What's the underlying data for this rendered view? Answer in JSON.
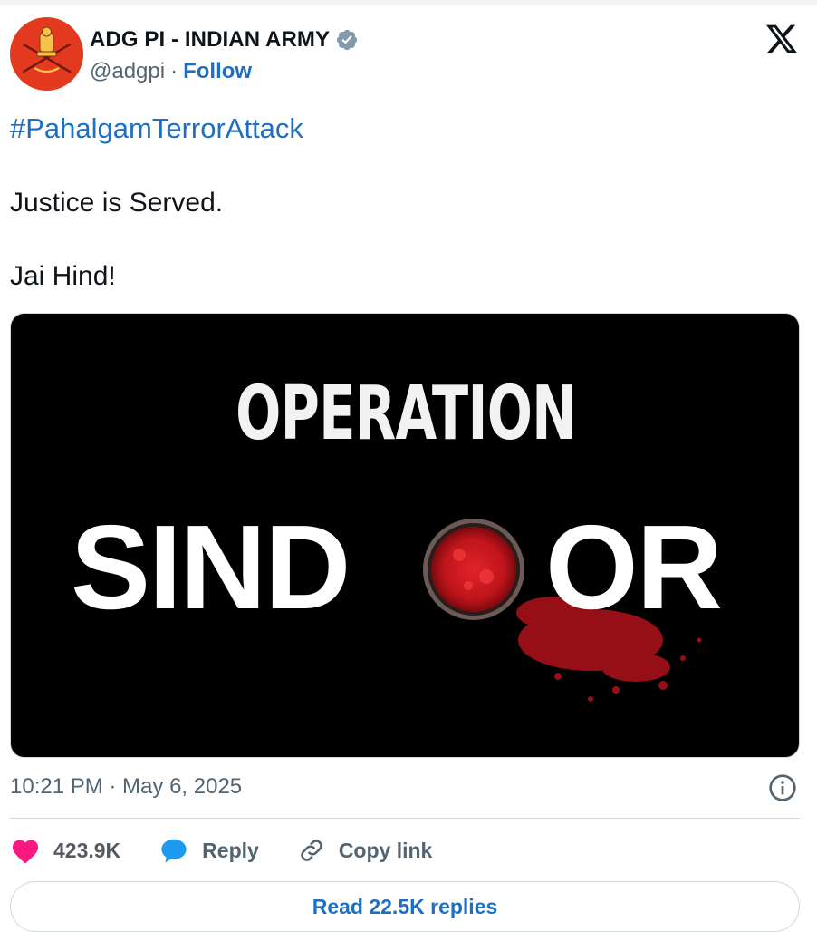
{
  "author": {
    "name": "ADG PI - INDIAN ARMY",
    "handle": "@adgpi",
    "separator": "·",
    "follow_label": "Follow",
    "verified": true,
    "avatar_color": "#e2391f"
  },
  "post": {
    "hashtag": "#PahalgamTerrorAttack",
    "lines": [
      "Justice is Served.",
      "Jai Hind!"
    ],
    "image": {
      "top_text": "OPERATION",
      "main_text_left": "SIND",
      "main_text_right": "OR",
      "background": "#000000",
      "accent": "#d4141c"
    },
    "timestamp": "10:21 PM · May 6, 2025"
  },
  "actions": {
    "likes": "423.9K",
    "reply_label": "Reply",
    "copy_label": "Copy link"
  },
  "read_replies_label": "Read 22.5K replies",
  "colors": {
    "link_blue": "#1d6fc4",
    "muted": "#536471",
    "like_pink": "#f91880",
    "reply_blue": "#1d9bf0",
    "border": "#cfd9de"
  },
  "icons": [
    "x-logo-icon",
    "verified-badge-icon",
    "heart-icon",
    "reply-bubble-icon",
    "link-icon",
    "info-icon",
    "army-emblem-icon"
  ]
}
